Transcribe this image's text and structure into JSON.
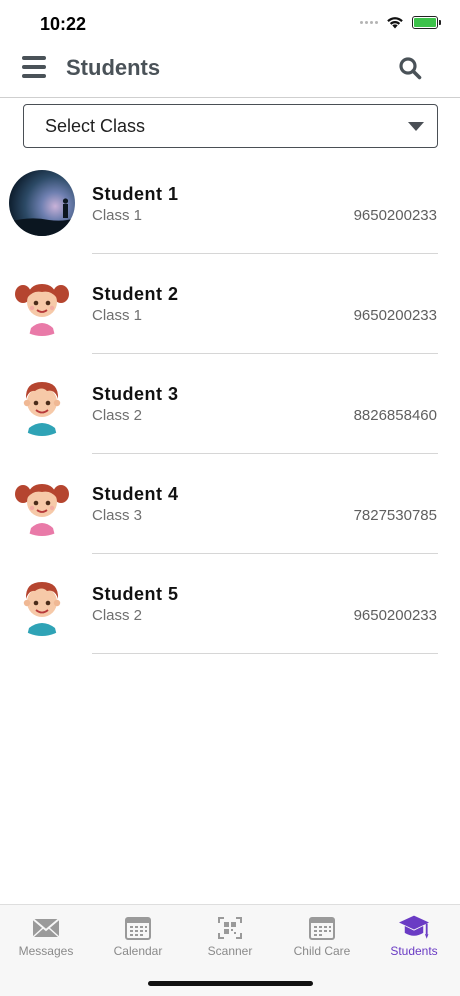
{
  "status_bar": {
    "time": "10:22",
    "battery_color": "#3cc24a"
  },
  "header": {
    "title": "Students",
    "menu_icon": "hamburger-menu-icon",
    "search_icon": "search-icon"
  },
  "filter": {
    "select_label": "Select Class"
  },
  "students": [
    {
      "name": "Student 1",
      "class": "Class 1",
      "phone": "9650200233",
      "avatar": "landscape-photo"
    },
    {
      "name": "Student 2",
      "class": "Class 1",
      "phone": "9650200233",
      "avatar": "girl-cartoon"
    },
    {
      "name": "Student 3",
      "class": "Class 2",
      "phone": "8826858460",
      "avatar": "boy-cartoon"
    },
    {
      "name": "Student 4",
      "class": "Class 3",
      "phone": "7827530785",
      "avatar": "girl-cartoon"
    },
    {
      "name": "Student 5",
      "class": "Class 2",
      "phone": "9650200233",
      "avatar": "boy-cartoon"
    }
  ],
  "tabs": [
    {
      "label": "Messages",
      "icon": "envelope-icon",
      "active": false
    },
    {
      "label": "Calendar",
      "icon": "calendar-icon",
      "active": false
    },
    {
      "label": "Scanner",
      "icon": "qr-scanner-icon",
      "active": false
    },
    {
      "label": "Child Care",
      "icon": "calendar-grid-icon",
      "active": false
    },
    {
      "label": "Students",
      "icon": "graduation-cap-icon",
      "active": true
    }
  ],
  "colors": {
    "accent": "#6a3bc4",
    "header_text": "#4a5258",
    "inactive_tab": "#8a8a8a"
  }
}
